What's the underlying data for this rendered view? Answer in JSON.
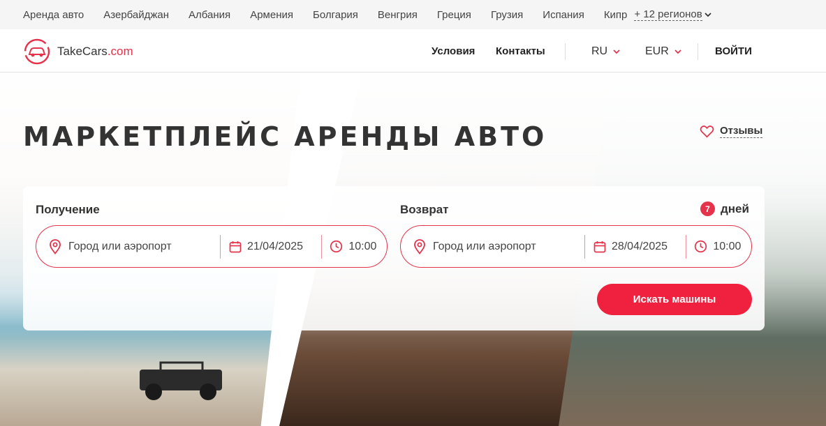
{
  "regions": {
    "items": [
      "Аренда авто",
      "Азербайджан",
      "Албания",
      "Армения",
      "Болгария",
      "Венгрия",
      "Греция",
      "Грузия",
      "Испания",
      "Кипр"
    ],
    "more_label": "+ 12 регионов"
  },
  "header": {
    "logo_name": "TakeCars",
    "logo_domain": ".com",
    "nav": {
      "terms": "Условия",
      "contacts": "Контакты"
    },
    "language": "RU",
    "currency": "EUR",
    "login": "ВОЙТИ"
  },
  "hero": {
    "title": "МАРКЕТПЛЕЙС АРЕНДЫ АВТО",
    "reviews": "Отзывы"
  },
  "search": {
    "pickup": {
      "label": "Получение",
      "location_placeholder": "Город или аэропорт",
      "date": "21/04/2025",
      "time": "10:00"
    },
    "return": {
      "label": "Возврат",
      "location_placeholder": "Город или аэропорт",
      "date": "28/04/2025",
      "time": "10:00"
    },
    "days_count": "7",
    "days_label": "дней",
    "submit": "Искать машины"
  },
  "colors": {
    "accent": "#e5334b",
    "button": "#f0213f"
  }
}
